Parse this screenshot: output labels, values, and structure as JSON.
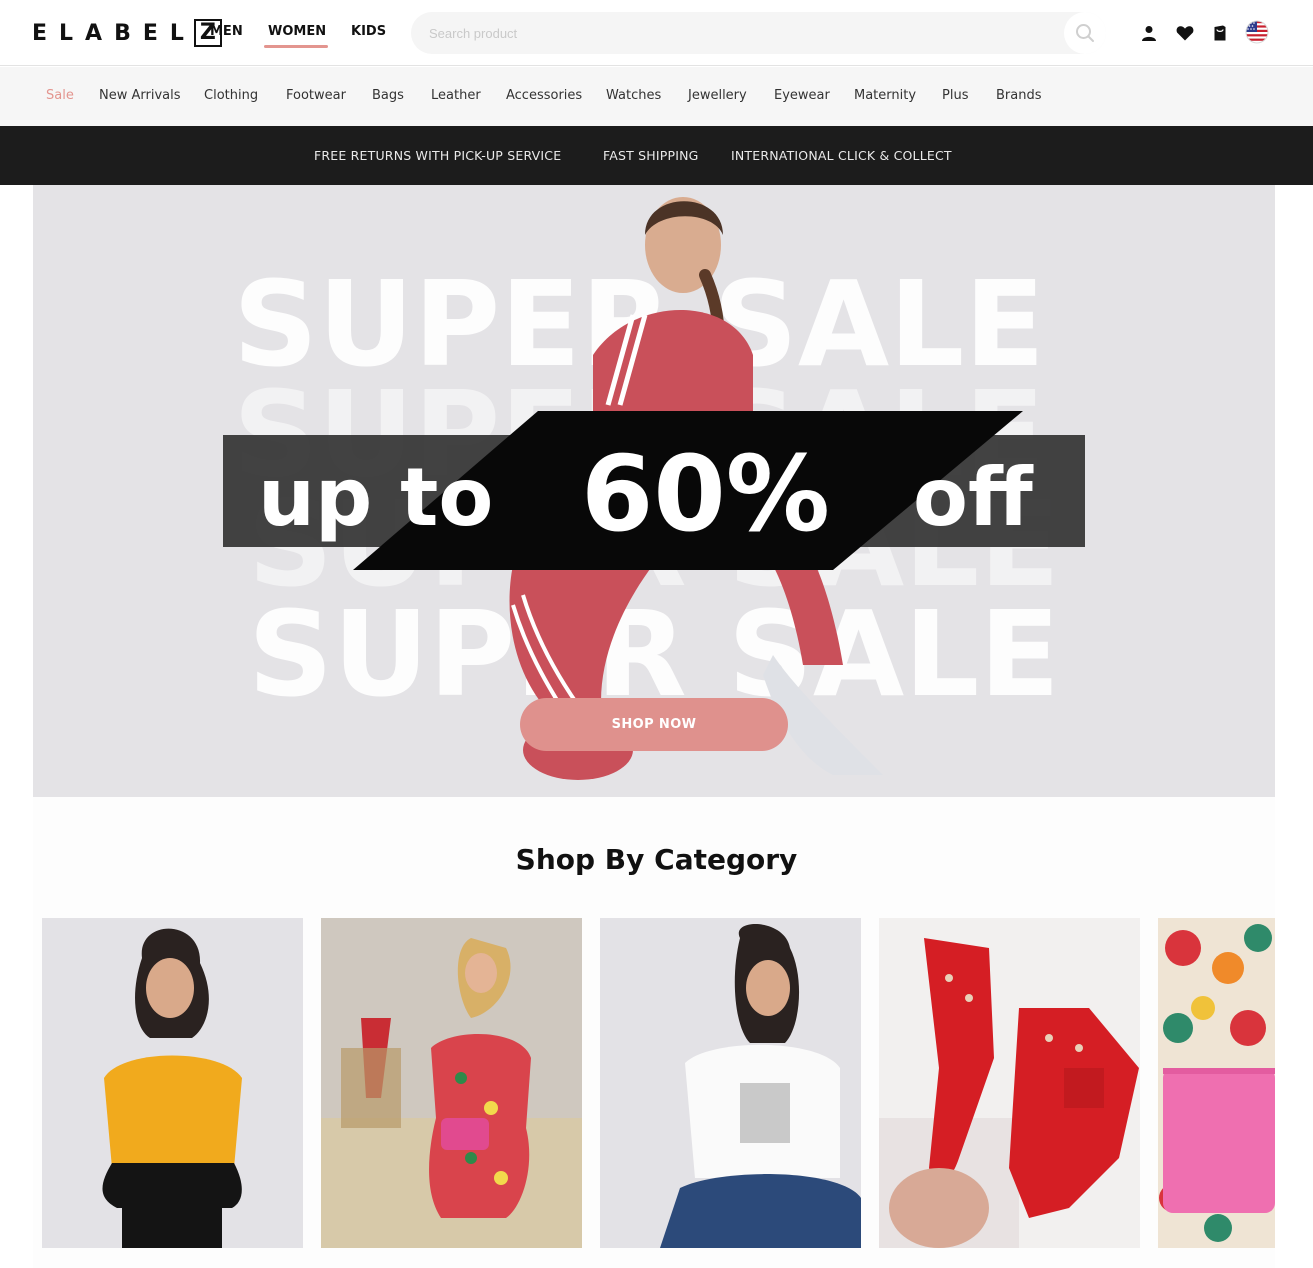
{
  "header": {
    "logo_text": "ELABEL",
    "logo_box_letter": "Z",
    "genders": [
      "MEN",
      "WOMEN",
      "KIDS"
    ],
    "active_gender": "WOMEN",
    "search_placeholder": "Search product",
    "icons": [
      "search-icon",
      "user-icon",
      "heart-icon",
      "bag-icon",
      "us-flag-icon"
    ]
  },
  "categories": [
    "Sale",
    "New Arrivals",
    "Clothing",
    "Footwear",
    "Bags",
    "Leather",
    "Accessories",
    "Watches",
    "Jewellery",
    "Eyewear",
    "Maternity",
    "Plus",
    "Brands"
  ],
  "info_strip": [
    "FREE RETURNS WITH PICK-UP SERVICE",
    "FAST SHIPPING",
    "INTERNATIONAL CLICK & COLLECT"
  ],
  "hero": {
    "background_word": "SUPER SALE",
    "headline_prefix": "up to",
    "headline_value": "60%",
    "headline_suffix": "off",
    "cta_label": "SHOP NOW"
  },
  "section": {
    "title": "Shop By Category"
  },
  "colors": {
    "accent": "#df918d",
    "sale_text": "#e3958f",
    "strip_bg": "#1c1c1c",
    "hero_bg": "#e4e3e6"
  }
}
